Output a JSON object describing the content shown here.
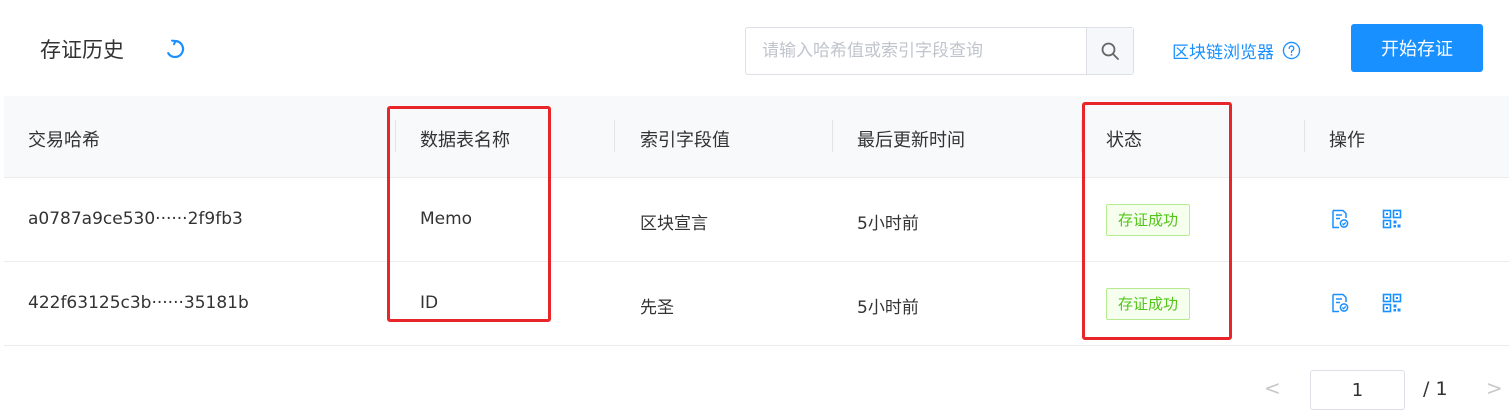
{
  "header": {
    "title": "存证历史",
    "search_placeholder": "请输入哈希值或索引字段查询",
    "explorer_link": "区块链浏览器",
    "start_button": "开始存证"
  },
  "table": {
    "columns": [
      "交易哈希",
      "数据表名称",
      "索引字段值",
      "最后更新时间",
      "状态",
      "操作"
    ],
    "rows": [
      {
        "hash": "a0787a9ce530······2f9fb3",
        "table_name": "Memo",
        "index_value": "区块宣言",
        "updated": "5小时前",
        "status": "存证成功"
      },
      {
        "hash": "422f63125c3b······35181b",
        "table_name": "ID",
        "index_value": "先圣",
        "updated": "5小时前",
        "status": "存证成功"
      }
    ]
  },
  "pagination": {
    "current_page": "1",
    "total": "/ 1",
    "prev": "<",
    "next": ">"
  },
  "colors": {
    "accent": "#1890ff",
    "success": "#52c41a",
    "highlight": "#e8262a"
  }
}
